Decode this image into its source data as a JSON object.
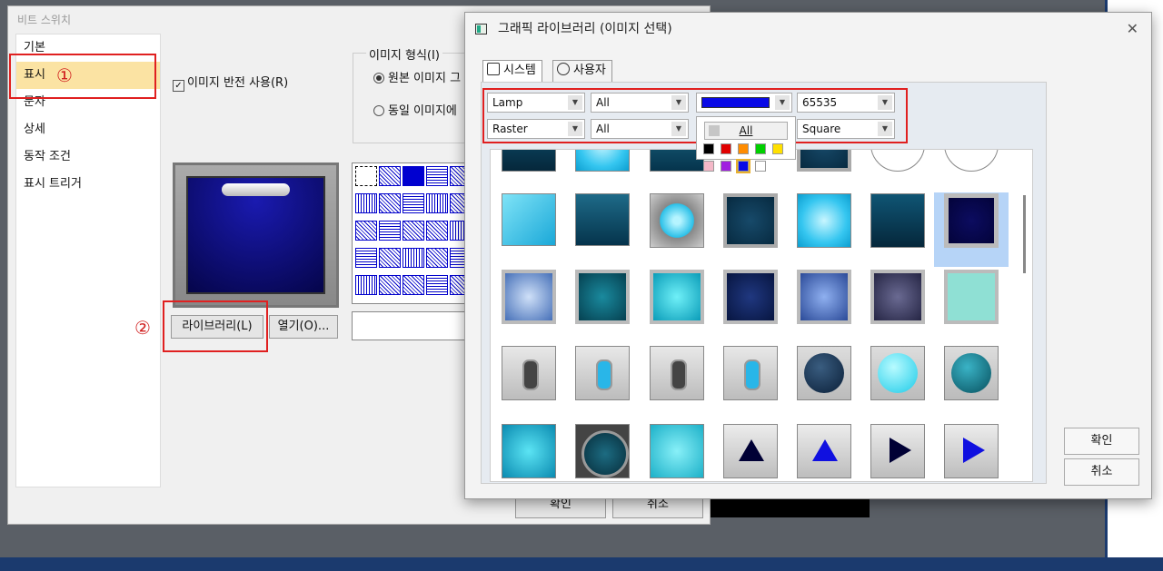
{
  "bg_dialog": {
    "title": "비트 스위치",
    "nav_items": [
      "기본",
      "표시",
      "문자",
      "상세",
      "동작 조건",
      "표시 트리거"
    ],
    "marker1": "①",
    "marker2": "②",
    "invert_check": "이미지 반전 사용(R)",
    "format_group_title": "이미지 형식(I)",
    "radio_original": "원본 이미지 그",
    "radio_same": "동일 이미지에",
    "library_button": "라이브러리(L)",
    "open_button": "열기(O)...",
    "ok_button": "확인",
    "cancel_button": "취소"
  },
  "library": {
    "title": "그래픽 라이브러리 (이미지 선택)",
    "close_glyph": "✕",
    "tabs": [
      "시스템",
      "사용자"
    ],
    "filters": {
      "type": "Lamp",
      "category": "All",
      "color_value": "65535",
      "format": "Raster",
      "category2": "All",
      "shape": "Square",
      "color_hex": "#0a0ae6"
    },
    "color_popup": {
      "all_label": "All",
      "colors": [
        "#000000",
        "#e00000",
        "#ff8c00",
        "#00d000",
        "#ffe000",
        "#f4b8c8",
        "#a020e0",
        "#0a0ae6",
        "#ffffff"
      ]
    },
    "ok_button": "확인",
    "cancel_button": "취소"
  }
}
